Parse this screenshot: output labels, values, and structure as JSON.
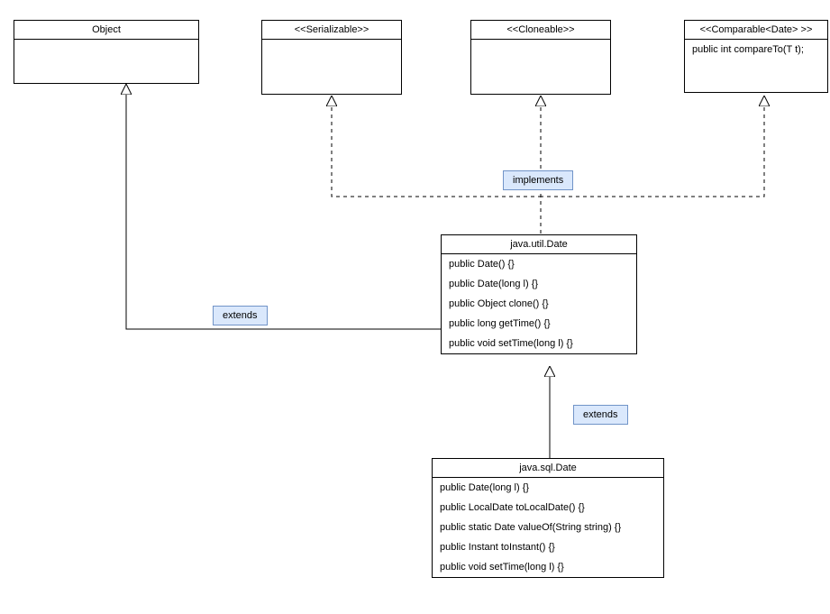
{
  "classes": {
    "object": {
      "title": "Object"
    },
    "serializable": {
      "title": "<<Serializable>>"
    },
    "cloneable": {
      "title": "<<Cloneable>>"
    },
    "comparable": {
      "title": "<<Comparable<Date> >>",
      "methods": [
        "public int compareTo(T t);"
      ]
    },
    "utilDate": {
      "title": "java.util.Date",
      "methods": [
        "public Date() {}",
        "public Date(long l) {}",
        " public Object clone() {}",
        "public long getTime() {}",
        "public void setTime(long l) {}"
      ]
    },
    "sqlDate": {
      "title": "java.sql.Date",
      "methods": [
        "public Date(long l) {}",
        "public LocalDate toLocalDate() {}",
        "public static Date valueOf(String string) {}",
        "public Instant toInstant() {}",
        "public void setTime(long l) {}"
      ]
    }
  },
  "labels": {
    "implements": "implements",
    "extendsObject": "extends",
    "extendsUtil": "extends"
  }
}
